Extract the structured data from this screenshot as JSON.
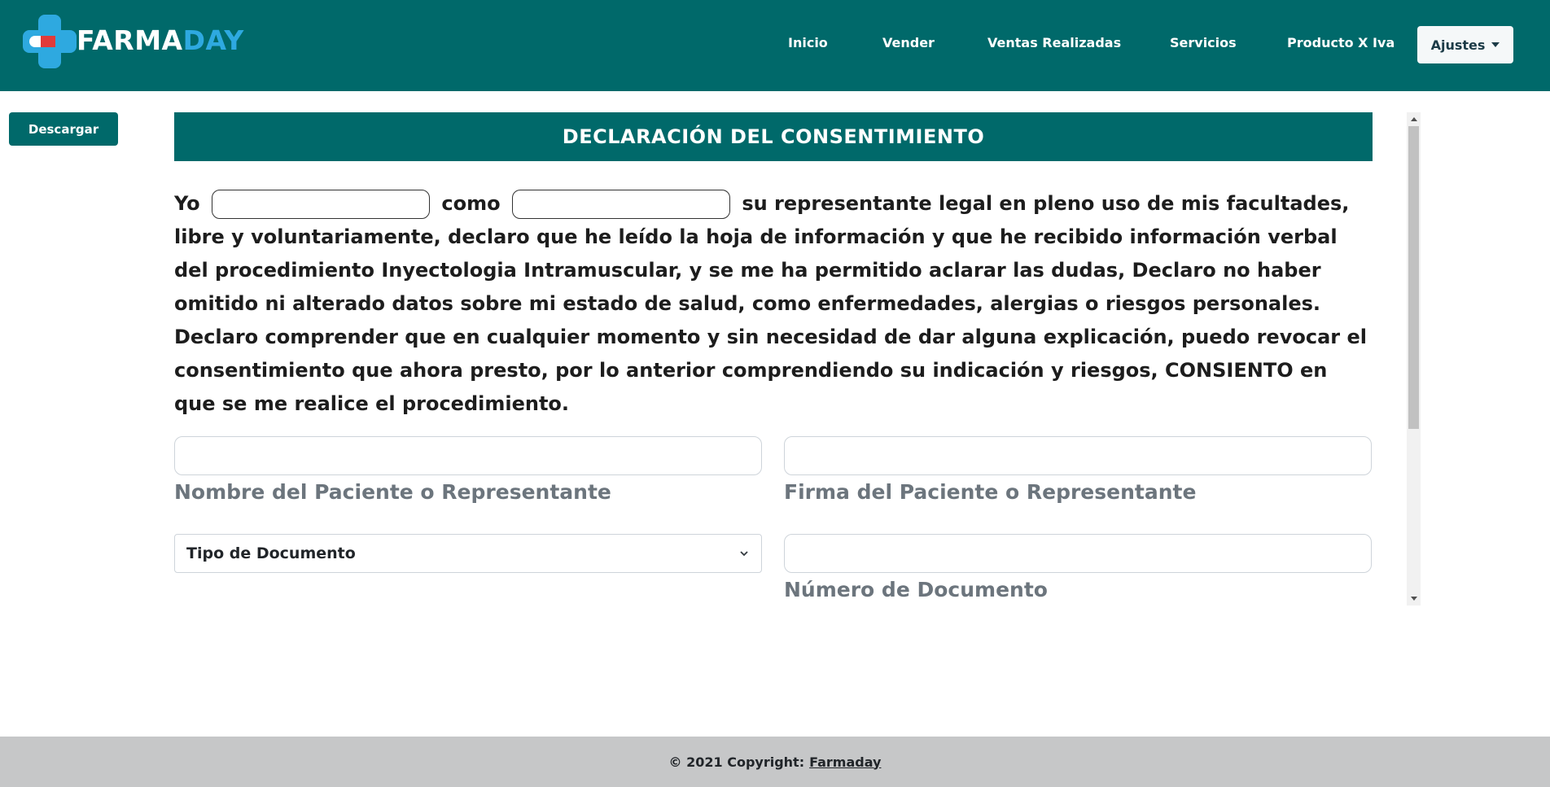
{
  "brand": {
    "part1": "FARMA",
    "part2": "DAY",
    "primary_color": "#00696a",
    "accent_color": "#2ea9e0",
    "pill_color": "#e23a3a"
  },
  "nav": {
    "items": [
      {
        "label": "Inicio"
      },
      {
        "label": "Vender"
      },
      {
        "label": "Ventas Realizadas"
      },
      {
        "label": "Servicios"
      },
      {
        "label": "Producto X Iva"
      }
    ],
    "settings_label": "Ajustes"
  },
  "download_label": "Descargar",
  "document": {
    "title": "DECLARACIÓN DEL CONSENTIMIENTO",
    "consent": {
      "word_yo": "Yo",
      "word_como": "como",
      "rest": "su representante legal en pleno uso de mis facultades, libre y voluntariamente, declaro que he leído la hoja de información y que he recibido información verbal del procedimiento Inyectologia Intramuscular, y se me ha permitido aclarar las dudas, Declaro no haber omitido ni alterado datos sobre mi estado de salud, como enfermedades, alergias o riesgos personales. Declaro comprender que en cualquier momento y sin necesidad de dar alguna explicación, puedo revocar el consentimiento que ahora presto, por lo anterior comprendiendo su indicación y riesgos, CONSIENTO en que se me realice el procedimiento."
    },
    "fields": {
      "patient_name_label": "Nombre del Paciente o Representante",
      "patient_signature_label": "Firma del Paciente o Representante",
      "document_type_selected": "Tipo de Documento",
      "document_number_label": "Número de Documento"
    }
  },
  "footer": {
    "text": "© 2021 Copyright:",
    "link": "Farmaday"
  }
}
